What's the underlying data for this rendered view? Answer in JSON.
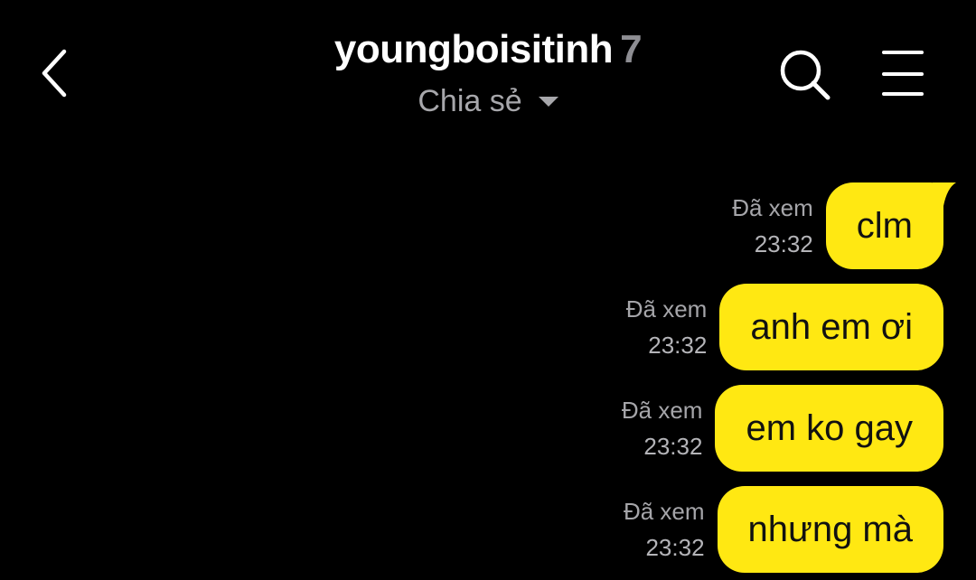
{
  "header": {
    "title": "youngboisitinh",
    "member_count": "7",
    "subtitle": "Chia sẻ",
    "back_icon": "chevron-left-icon",
    "search_icon": "search-icon",
    "menu_icon": "hamburger-menu-icon"
  },
  "colors": {
    "background": "#000000",
    "bubble": "#ffe812",
    "bubble_text": "#111111",
    "meta_text": "#b4b4b8"
  },
  "messages": [
    {
      "text": "clm",
      "status": "Đã xem",
      "time": "23:32"
    },
    {
      "text": "anh em ơi",
      "status": "Đã xem",
      "time": "23:32"
    },
    {
      "text": "em ko gay",
      "status": "Đã xem",
      "time": "23:32"
    },
    {
      "text": "nhưng mà",
      "status": "Đã xem",
      "time": "23:32"
    }
  ]
}
